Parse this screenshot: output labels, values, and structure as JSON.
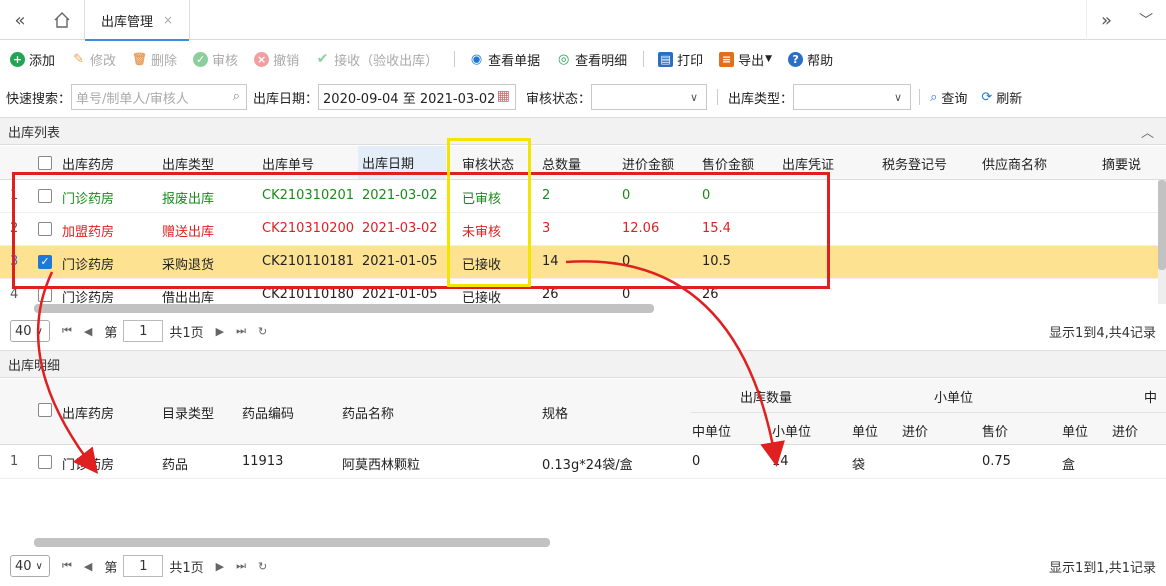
{
  "tabs": {
    "active_label": "出库管理",
    "close": "×"
  },
  "toolbar": {
    "add": "添加",
    "edit": "修改",
    "delete": "删除",
    "audit": "审核",
    "revoke": "撤销",
    "receive": "接收（验收出库）",
    "view_doc": "查看单据",
    "view_detail": "查看明细",
    "print": "打印",
    "export": "导出",
    "help": "帮助"
  },
  "search": {
    "quick_label": "快速搜索：",
    "quick_placeholder": "单号/制单人/审核人",
    "date_label": "出库日期：",
    "date_range": "2020-09-04 至 2021-03-02",
    "audit_label": "审核状态：",
    "type_label": "出库类型：",
    "query": "查询",
    "refresh": "刷新"
  },
  "list": {
    "title": "出库列表",
    "columns": [
      "出库药房",
      "出库类型",
      "出库单号",
      "出库日期",
      "审核状态",
      "总数量",
      "进价金额",
      "售价金额",
      "出库凭证",
      "税务登记号",
      "供应商名称",
      "摘要说"
    ],
    "rows": [
      {
        "n": "1",
        "pharmacy": "门诊药房",
        "type": "报废出库",
        "no": "CK210310201",
        "date": "2021-03-02",
        "status": "已审核",
        "qty": "2",
        "cost": "0",
        "price": "0",
        "color": "green",
        "checked": false
      },
      {
        "n": "2",
        "pharmacy": "加盟药房",
        "type": "赠送出库",
        "no": "CK210310200",
        "date": "2021-03-02",
        "status": "未审核",
        "qty": "3",
        "cost": "12.06",
        "price": "15.4",
        "color": "red",
        "checked": false
      },
      {
        "n": "3",
        "pharmacy": "门诊药房",
        "type": "采购退货",
        "no": "CK210110181",
        "date": "2021-01-05",
        "status": "已接收",
        "qty": "14",
        "cost": "0",
        "price": "10.5",
        "color": "normal",
        "checked": true
      },
      {
        "n": "4",
        "pharmacy": "门诊药房",
        "type": "借出出库",
        "no": "CK210110180",
        "date": "2021-01-05",
        "status": "已接收",
        "qty": "26",
        "cost": "0",
        "price": "26",
        "color": "normal",
        "checked": false
      }
    ],
    "pager": {
      "size": "40",
      "page_prefix": "第",
      "page": "1",
      "total_pages": "共1页",
      "info": "显示1到4,共4记录"
    }
  },
  "detail": {
    "title": "出库明细",
    "group_out_qty": "出库数量",
    "group_small": "小单位",
    "group_mid": "中",
    "columns": [
      "出库药房",
      "目录类型",
      "药品编码",
      "药品名称",
      "规格"
    ],
    "sub": {
      "mid_unit": "中单位",
      "small_unit": "小单位",
      "unit": "单位",
      "cost": "进价",
      "price": "售价",
      "unit2": "单位",
      "cost2": "进价"
    },
    "rows": [
      {
        "n": "1",
        "pharmacy": "门诊药房",
        "cat": "药品",
        "code": "11913",
        "name": "阿莫西林颗粒",
        "spec": "0.13g*24袋/盒",
        "mid": "0",
        "small": "14",
        "unit": "袋",
        "cost": "",
        "price": "0.75",
        "unit2": "盒",
        "cost2": ""
      }
    ],
    "pager": {
      "size": "40",
      "page_prefix": "第",
      "page": "1",
      "total_pages": "共1页",
      "info": "显示1到1,共1记录"
    }
  },
  "colors": {
    "accent": "#1e78d7",
    "highlight_row": "#fde391",
    "annotation_red": "#e02020",
    "annotation_yellow": "#f2e600"
  }
}
